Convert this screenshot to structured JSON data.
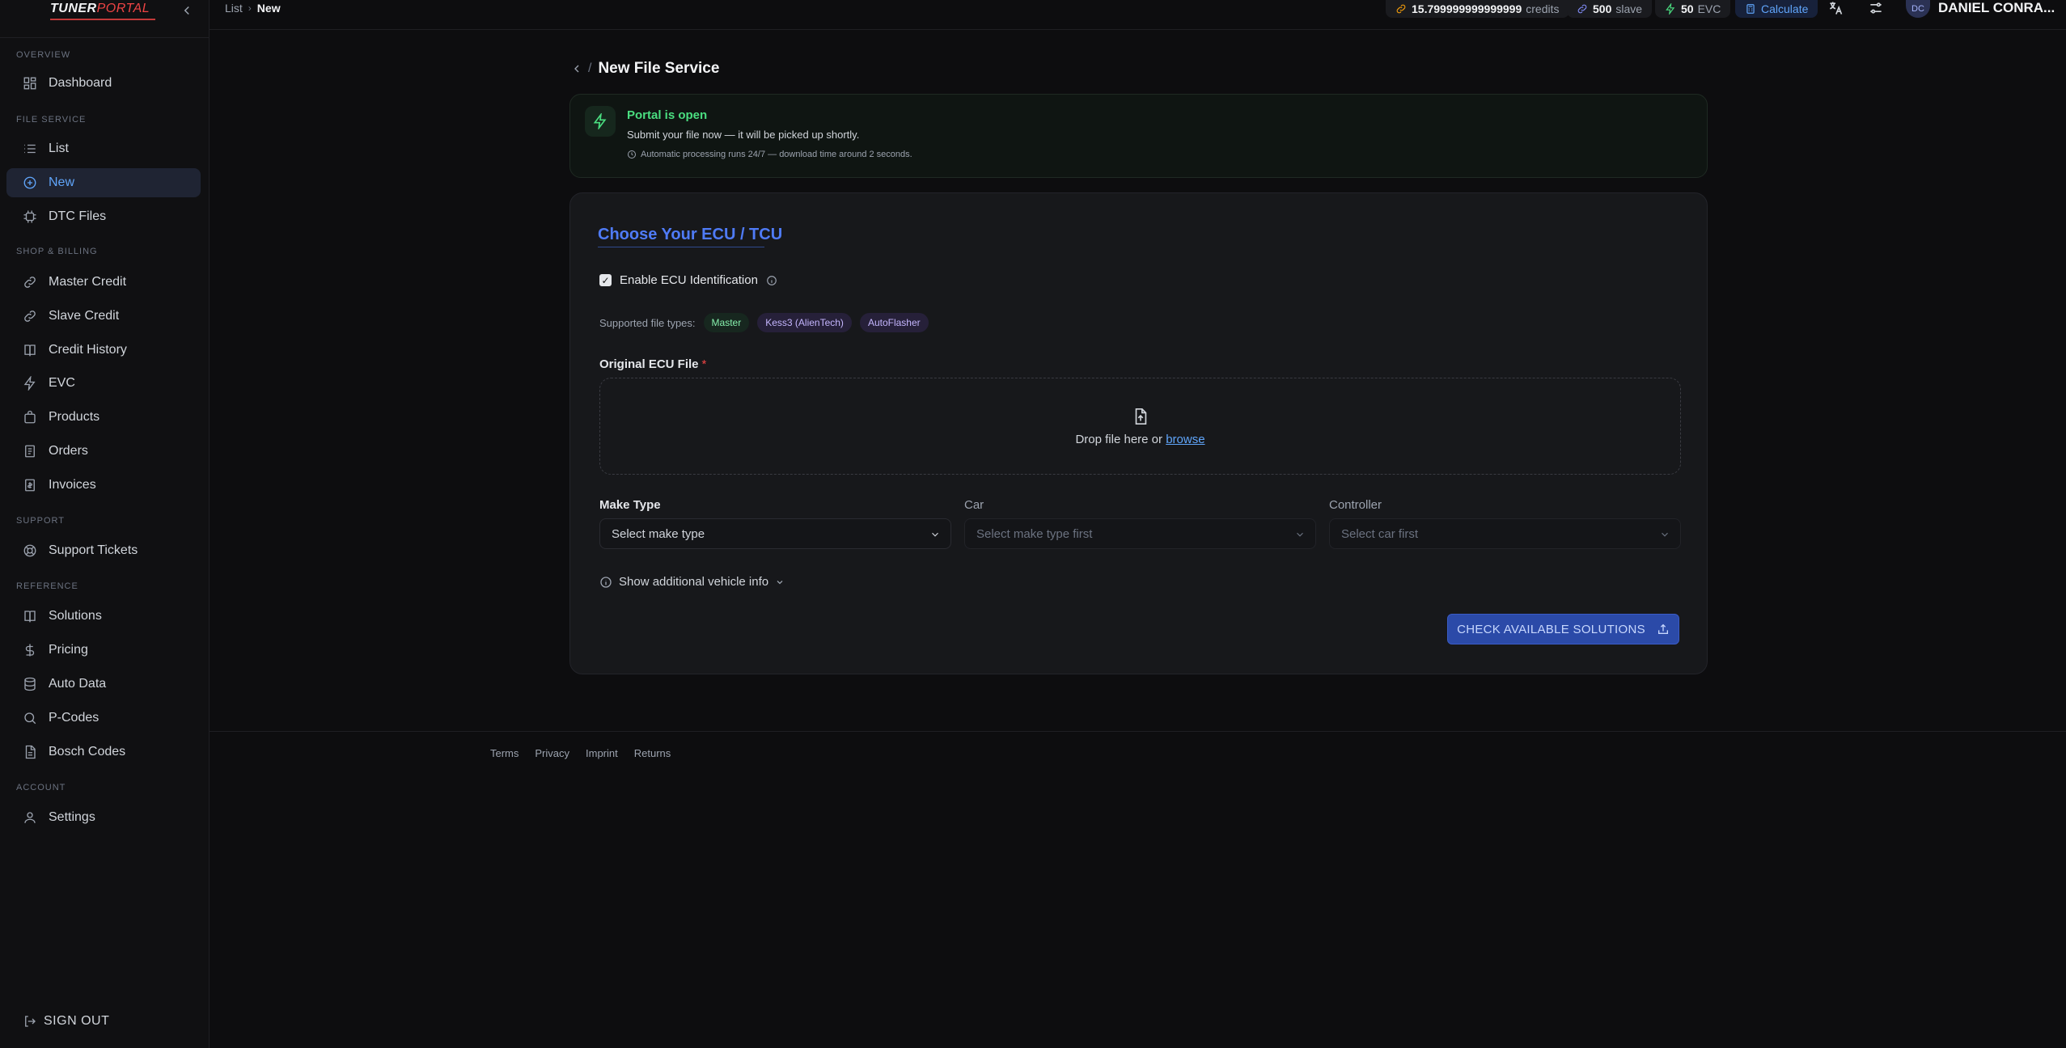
{
  "brand": {
    "name_part1": "TUNER",
    "name_part2": "PORTAL"
  },
  "sidebar": {
    "sections": {
      "overview": "OVERVIEW",
      "file_service": "FILE SERVICE",
      "shop_billing": "SHOP & BILLING",
      "support": "SUPPORT",
      "reference": "REFERENCE",
      "account": "ACCOUNT"
    },
    "items": {
      "dashboard": "Dashboard",
      "list": "List",
      "new": "New",
      "dtc_files": "DTC Files",
      "master_credit": "Master Credit",
      "slave_credit": "Slave Credit",
      "credit_history": "Credit History",
      "evc": "EVC",
      "products": "Products",
      "orders": "Orders",
      "invoices": "Invoices",
      "support_tickets": "Support Tickets",
      "solutions": "Solutions",
      "pricing": "Pricing",
      "auto_data": "Auto Data",
      "p_codes": "P-Codes",
      "bosch_codes": "Bosch Codes",
      "settings": "Settings"
    },
    "active_item": "new",
    "sign_out": "SIGN OUT"
  },
  "header": {
    "breadcrumb": {
      "parent": "List",
      "current": "New"
    },
    "credits": {
      "value": "15.799999999999999",
      "label": "credits"
    },
    "slave": {
      "value": "500",
      "label": "slave"
    },
    "evc": {
      "value": "50",
      "label": "EVC"
    },
    "calculate": "Calculate",
    "user": {
      "initials": "DC",
      "name": "DANIEL CONRA..."
    }
  },
  "page": {
    "title": "New File Service",
    "banner": {
      "heading": "Portal is open",
      "subtitle": "Submit your file now — it will be picked up shortly.",
      "note": "Automatic processing runs 24/7 — download time around 2 seconds."
    },
    "form": {
      "title": "Choose Your ECU / TCU",
      "ecu_identification": {
        "label": "Enable ECU Identification",
        "checked": true
      },
      "supported_label": "Supported file types:",
      "file_types": [
        "Master",
        "Kess3 (AlienTech)",
        "AutoFlasher"
      ],
      "file_field": {
        "label": "Original ECU File",
        "required_mark": "*"
      },
      "dropzone": {
        "text": "Drop file here or",
        "link": "browse"
      },
      "make_type": {
        "label": "Make Type",
        "placeholder": "Select make type"
      },
      "car": {
        "label": "Car",
        "placeholder": "Select make type first"
      },
      "controller": {
        "label": "Controller",
        "placeholder": "Select car first"
      },
      "additional_info": "Show additional vehicle info",
      "submit": "CHECK AVAILABLE SOLUTIONS"
    }
  },
  "footer": {
    "links": [
      "Terms",
      "Privacy",
      "Imprint",
      "Returns"
    ]
  },
  "colors": {
    "accent": "#4f7bf7",
    "active_nav": "#60a5fa",
    "success": "#4ade80",
    "required": "#ef4444"
  }
}
